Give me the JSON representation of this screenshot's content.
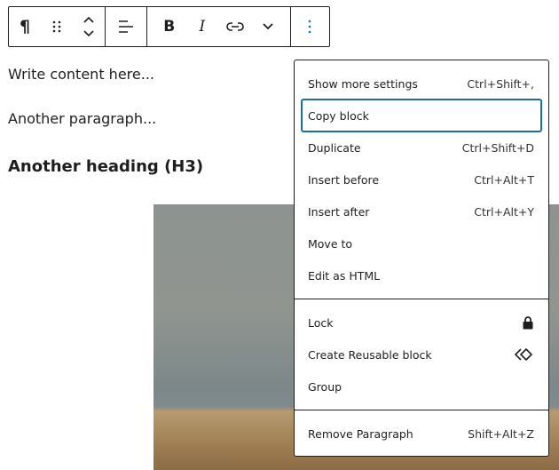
{
  "toolbar": {
    "paragraph": "¶",
    "drag": "⠿",
    "move_up": "⌃",
    "move_down": "⌄",
    "align": "≡",
    "bold": "B",
    "italic": "I",
    "link": "⊖",
    "more": "⌄",
    "options": "⋮"
  },
  "content": {
    "p1": "Write content here...",
    "p2": "Another paragraph...",
    "h3": "Another heading (H3)"
  },
  "menu": {
    "section1": [
      {
        "label": "Show more settings",
        "shortcut": "Ctrl+Shift+,"
      },
      {
        "label": "Copy block",
        "shortcut": ""
      },
      {
        "label": "Duplicate",
        "shortcut": "Ctrl+Shift+D"
      },
      {
        "label": "Insert before",
        "shortcut": "Ctrl+Alt+T"
      },
      {
        "label": "Insert after",
        "shortcut": "Ctrl+Alt+Y"
      },
      {
        "label": "Move to",
        "shortcut": ""
      },
      {
        "label": "Edit as HTML",
        "shortcut": ""
      }
    ],
    "section2": [
      {
        "label": "Lock",
        "icon": "lock-icon"
      },
      {
        "label": "Create Reusable block",
        "icon": "reusable-block-icon"
      },
      {
        "label": "Group"
      }
    ],
    "section3": [
      {
        "label": "Remove Paragraph",
        "shortcut": "Shift+Alt+Z"
      }
    ]
  },
  "colors": {
    "focus": "#1a6e99",
    "accent": "#007cba"
  }
}
